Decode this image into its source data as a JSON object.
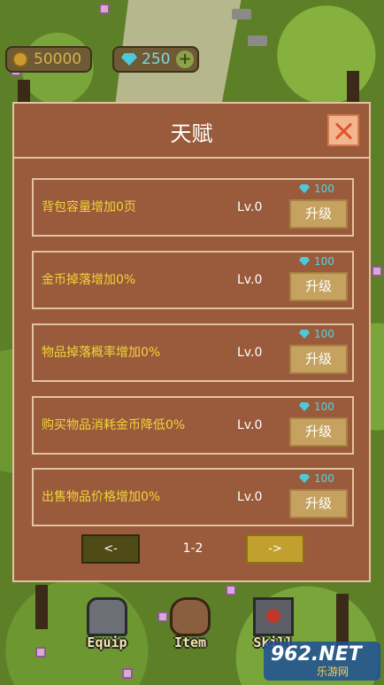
{
  "currency": {
    "gold": "50000",
    "gems": "250"
  },
  "dialog": {
    "title": "天赋",
    "talents": [
      {
        "name": "背包容量增加0页",
        "level": "Lv.0",
        "cost": "100",
        "upgrade_label": "升级"
      },
      {
        "name": "金币掉落增加0%",
        "level": "Lv.0",
        "cost": "100",
        "upgrade_label": "升级"
      },
      {
        "name": "物品掉落概率增加0%",
        "level": "Lv.0",
        "cost": "100",
        "upgrade_label": "升级"
      },
      {
        "name": "购买物品消耗金币降低0%",
        "level": "Lv.0",
        "cost": "100",
        "upgrade_label": "升级"
      },
      {
        "name": "出售物品价格增加0%",
        "level": "Lv.0",
        "cost": "100",
        "upgrade_label": "升级"
      }
    ],
    "pager": {
      "prev_label": "<-",
      "page": "1-2",
      "next_label": "->"
    }
  },
  "nav": {
    "equip": "Equip",
    "item": "Item",
    "skill": "Skill"
  },
  "watermark": {
    "main": "962.NET",
    "sub": "乐游网"
  },
  "colors": {
    "panel": "#9a5b3c",
    "border": "#e1c3a3",
    "talent_text": "#f1d338",
    "gem_cost": "#54d2e3",
    "upgrade_button": "#c5a260"
  }
}
